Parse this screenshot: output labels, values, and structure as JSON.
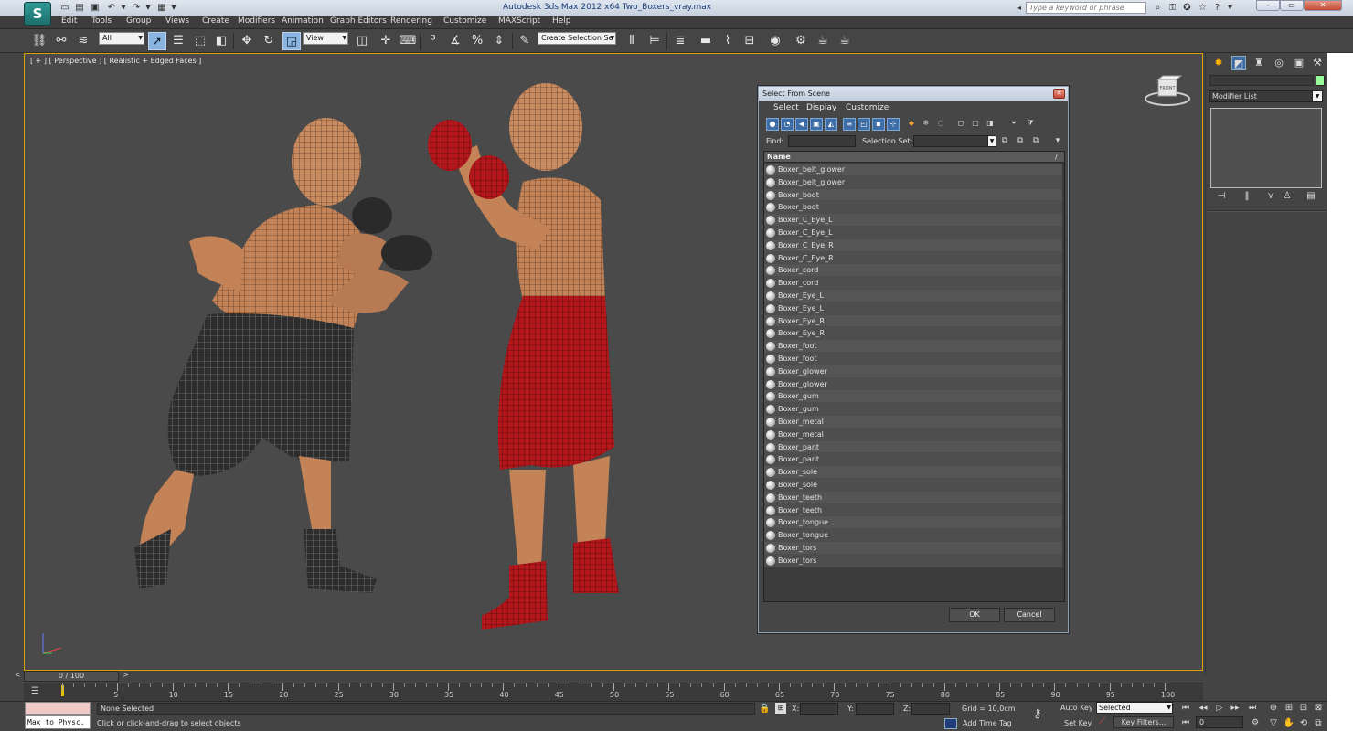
{
  "window": {
    "title": "Autodesk 3ds Max  2012 x64      Two_Boxers_vray.max",
    "search_placeholder": "Type a keyword or phrase",
    "logo": "S"
  },
  "menu": [
    "Edit",
    "Tools",
    "Group",
    "Views",
    "Create",
    "Modifiers",
    "Animation",
    "Graph Editors",
    "Rendering",
    "Customize",
    "MAXScript",
    "Help"
  ],
  "toolbar": {
    "filter": "All",
    "ref_coord": "View",
    "selection_set_placeholder": "Create Selection Se"
  },
  "viewport": {
    "label": "[ + ] [ Perspective ] [ Realistic + Edged Faces ]",
    "viewcube_label": "FRONT"
  },
  "command_panel": {
    "modifier_list": "Modifier List",
    "object_color": "#9aff9a"
  },
  "dialog": {
    "title": "Select From Scene",
    "menus": [
      "Select",
      "Display",
      "Customize"
    ],
    "find_label": "Find:",
    "selection_set_label": "Selection Set:",
    "column_name": "Name",
    "items": [
      "Boxer_belt_glower",
      "Boxer_belt_glower",
      "Boxer_boot",
      "Boxer_boot",
      "Boxer_C_Eye_L",
      "Boxer_C_Eye_L",
      "Boxer_C_Eye_R",
      "Boxer_C_Eye_R",
      "Boxer_cord",
      "Boxer_cord",
      "Boxer_Eye_L",
      "Boxer_Eye_L",
      "Boxer_Eye_R",
      "Boxer_Eye_R",
      "Boxer_foot",
      "Boxer_foot",
      "Boxer_glower",
      "Boxer_glower",
      "Boxer_gum",
      "Boxer_gum",
      "Boxer_metal",
      "Boxer_metal",
      "Boxer_pant",
      "Boxer_pant",
      "Boxer_sole",
      "Boxer_sole",
      "Boxer_teeth",
      "Boxer_teeth",
      "Boxer_tongue",
      "Boxer_tongue",
      "Boxer_tors",
      "Boxer_tors"
    ],
    "ok_label": "OK",
    "cancel_label": "Cancel"
  },
  "timeline": {
    "slider_label": "0 / 100",
    "current_frame": 0,
    "range_end": 100,
    "tick_labels": [
      "5",
      "10",
      "15",
      "20",
      "25",
      "30",
      "35",
      "40",
      "45",
      "50",
      "55",
      "60",
      "65",
      "70",
      "75",
      "80",
      "85",
      "90",
      "95",
      "100"
    ]
  },
  "status": {
    "maxscript": "Max to Physc.",
    "selection": "None Selected",
    "prompt": "Click or click-and-drag to select objects",
    "x_label": "X:",
    "y_label": "Y:",
    "z_label": "Z:",
    "grid": "Grid = 10,0cm",
    "add_time_tag": "Add Time Tag",
    "auto_key": "Auto Key",
    "set_key": "Set Key",
    "key_mode": "Selected",
    "key_filters": "Key Filters...",
    "frame": "0"
  }
}
